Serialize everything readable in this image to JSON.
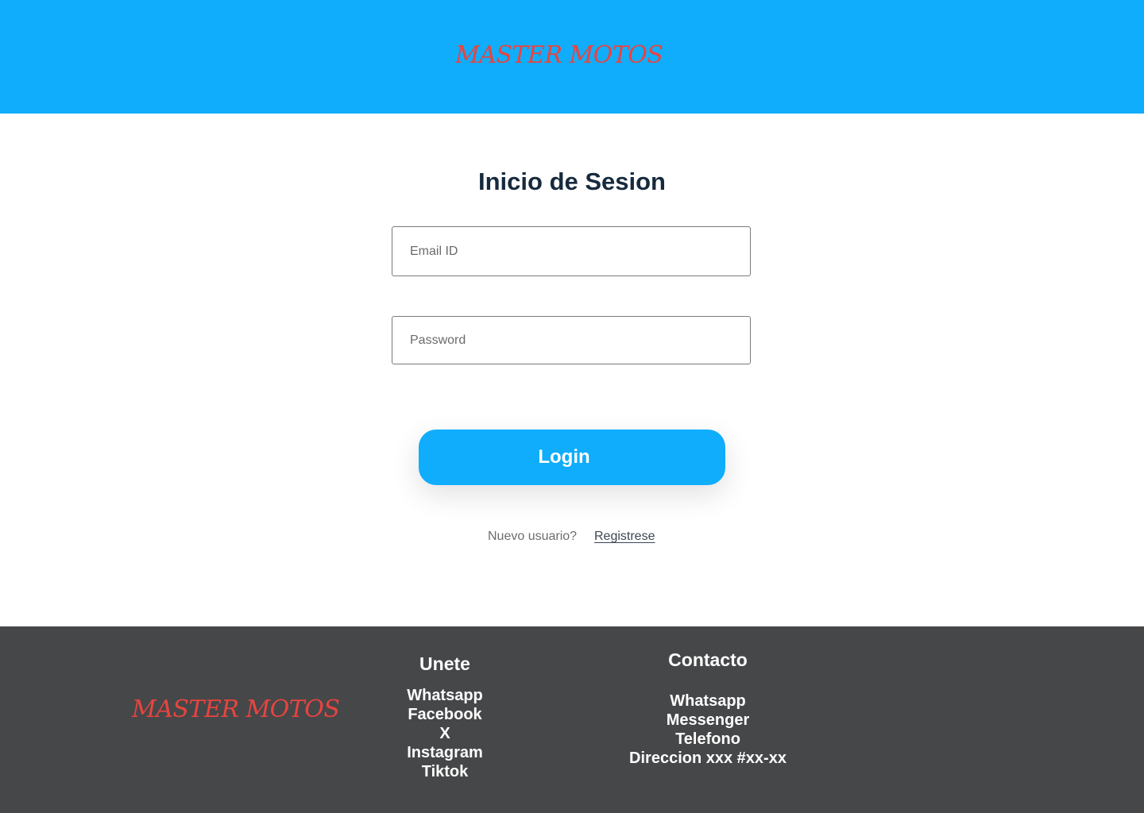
{
  "header": {
    "brand": "MASTER MOTOS"
  },
  "colors": {
    "primary": "#10adfc",
    "brand": "#e8443f",
    "footer_bg": "#464749",
    "title": "#172a3d"
  },
  "login": {
    "title": "Inicio de Sesion",
    "email_placeholder": "Email ID",
    "email_value": "",
    "password_placeholder": "Password",
    "password_value": "",
    "login_label": "Login",
    "new_user_text": "Nuevo usuario?",
    "register_label": "Registrese"
  },
  "footer": {
    "brand": "MASTER MOTOS",
    "unete": {
      "heading": "Unete",
      "items": [
        "Whatsapp",
        "Facebook",
        "X",
        "Instagram",
        "Tiktok"
      ]
    },
    "contacto": {
      "heading": "Contacto",
      "items": [
        "Whatsapp",
        "Messenger",
        "Telefono",
        "Direccion xxx #xx-xx"
      ]
    }
  }
}
